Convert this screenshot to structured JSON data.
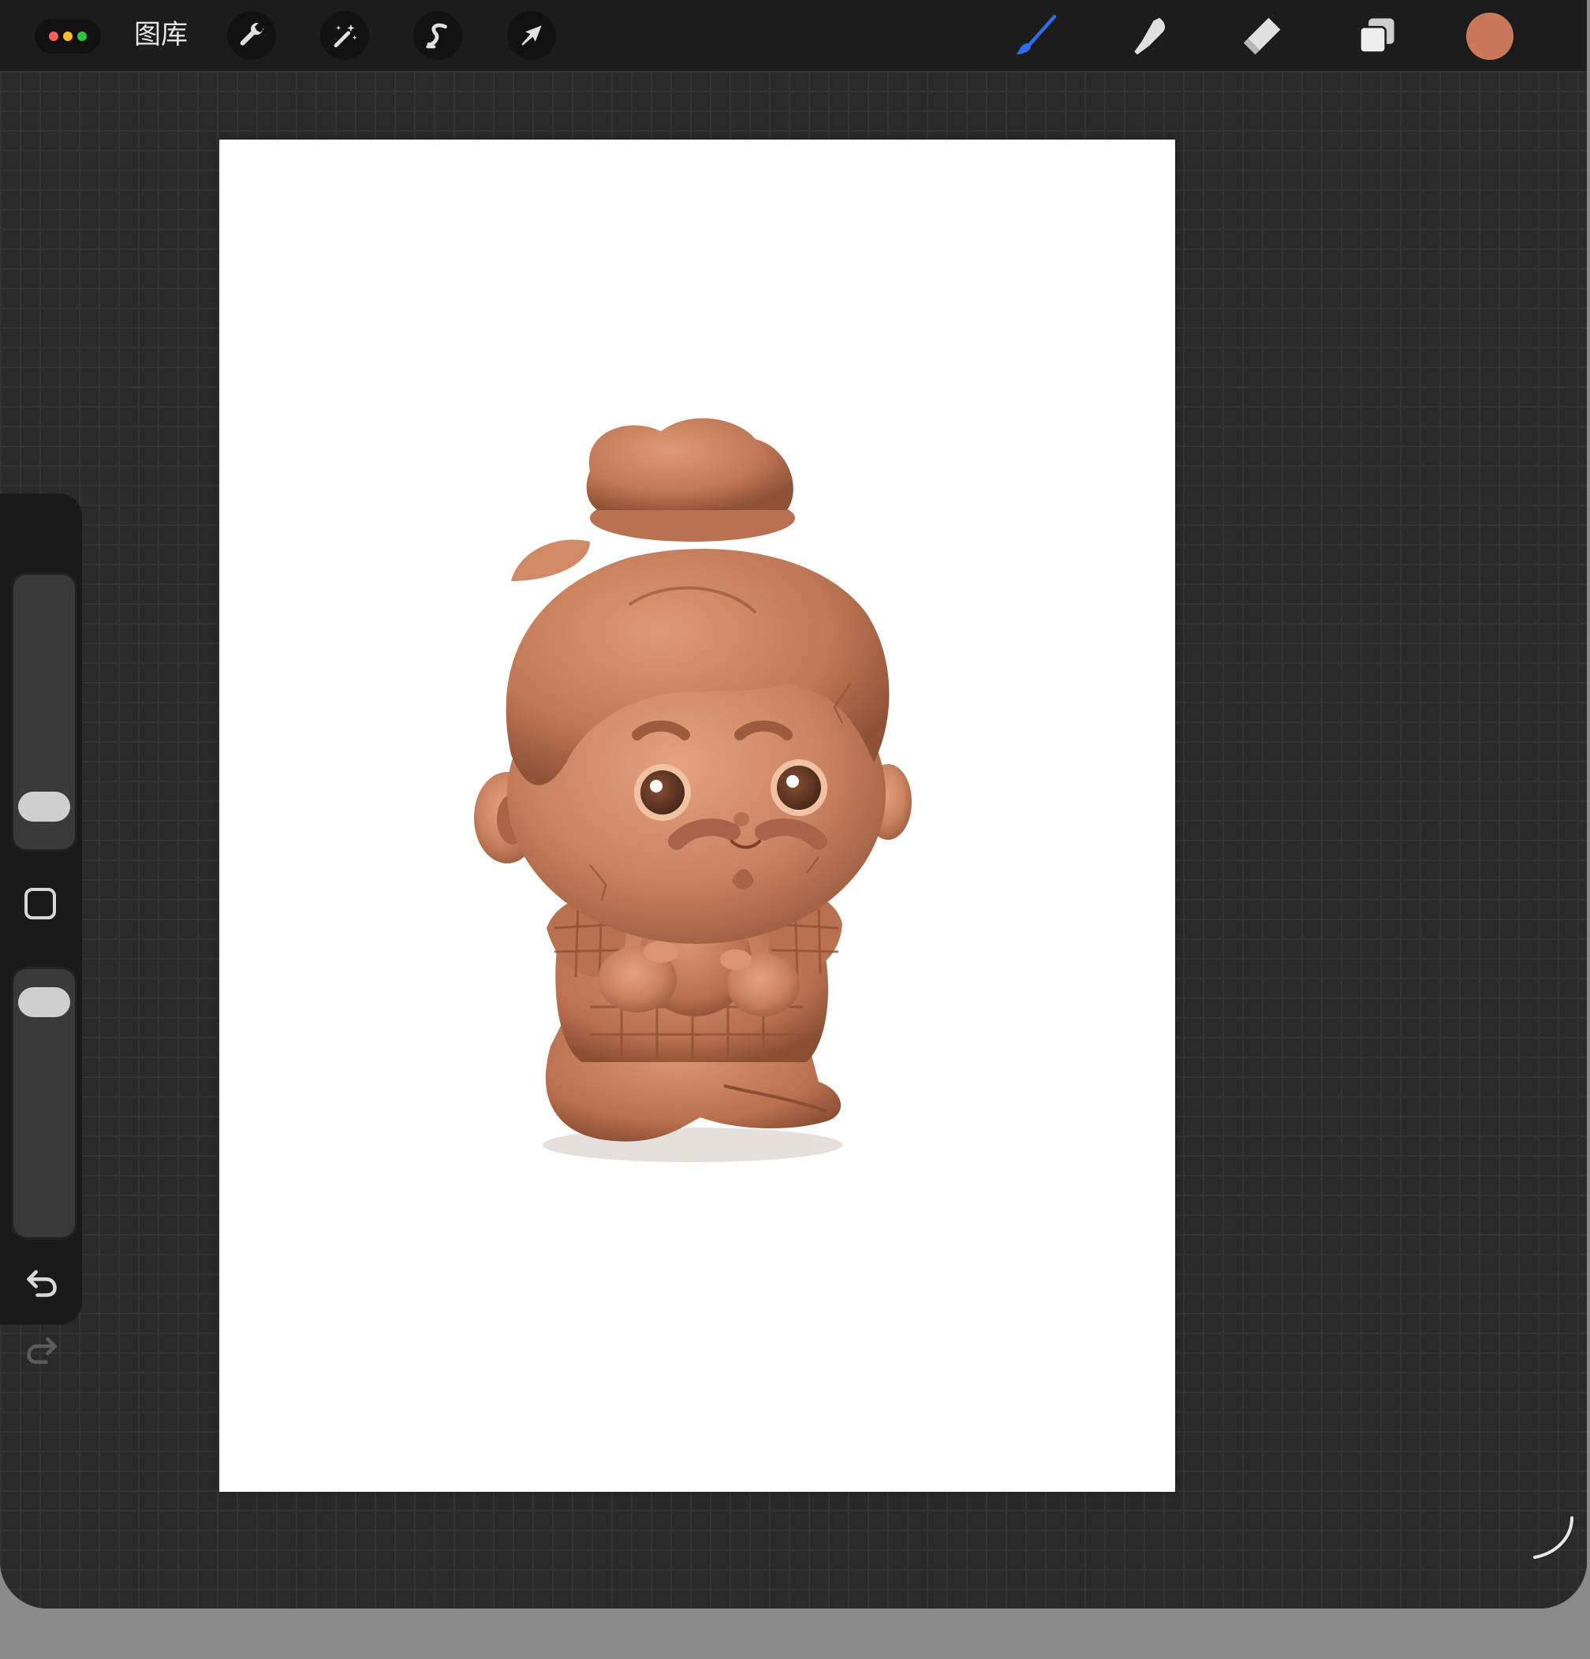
{
  "topbar": {
    "gallery_label": "图库",
    "left_tools": [
      {
        "name": "adjustments",
        "icon": "wrench-icon"
      },
      {
        "name": "adjustments-magic",
        "icon": "magic-wand-icon"
      },
      {
        "name": "selection",
        "icon": "selection-s-icon"
      },
      {
        "name": "transform",
        "icon": "arrow-cursor-icon"
      }
    ],
    "right_tools": [
      {
        "name": "brush",
        "icon": "brush-icon",
        "active": true
      },
      {
        "name": "smudge",
        "icon": "smudge-icon"
      },
      {
        "name": "eraser",
        "icon": "eraser-icon"
      },
      {
        "name": "layers",
        "icon": "layers-icon"
      }
    ],
    "current_color": "#c9785a"
  },
  "colors": {
    "active_tool": "#2f6df0",
    "window_dot_red": "#ff5f56",
    "window_dot_yellow": "#ffbd2e",
    "window_dot_green": "#27c93f"
  },
  "sidebar": {
    "brush_size_level": 0.08,
    "opacity_level": 0.06,
    "undo_icon": "undo-icon",
    "redo_icon": "redo-icon",
    "modify_icon": "square-icon"
  },
  "canvas": {
    "artwork": "terracotta-warrior-figurine"
  }
}
